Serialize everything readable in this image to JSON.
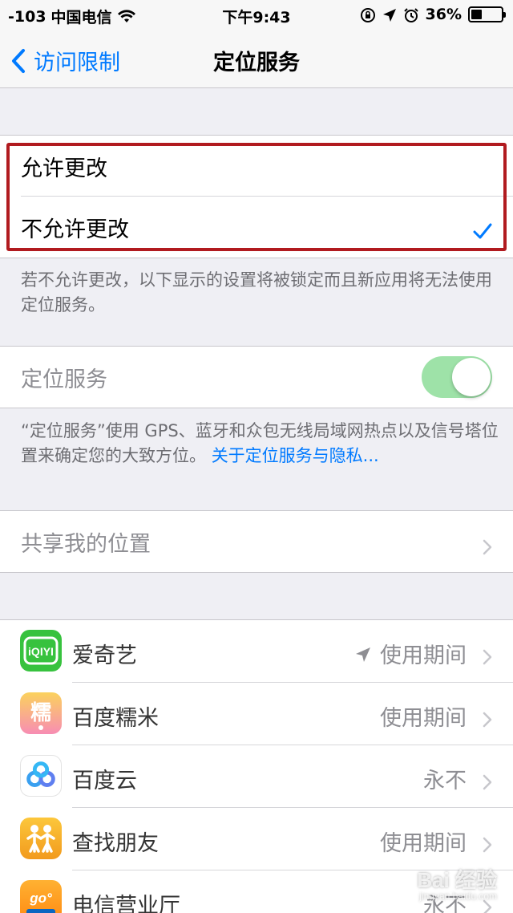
{
  "status_bar": {
    "signal": "-103",
    "carrier": "中国电信",
    "time": "下午9:43",
    "battery": "36%",
    "battery_level": 0.36
  },
  "nav": {
    "back_label": "访问限制",
    "title": "定位服务"
  },
  "change_options": [
    {
      "label": "允许更改",
      "selected": false
    },
    {
      "label": "不允许更改",
      "selected": true
    }
  ],
  "change_footnote": "若不允许更改，以下显示的设置将被锁定而且新应用将无法使用定位服务。",
  "location_services": {
    "label": "定位服务",
    "enabled": true,
    "footnote": "“定位服务”使用 GPS、蓝牙和众包无线局域网热点以及信号塔位置来确定您的大致方位。",
    "footnote_link": "关于定位服务与隐私..."
  },
  "share_location": {
    "label": "共享我的位置"
  },
  "apps": [
    {
      "name": "爱奇艺",
      "value": "使用期间",
      "location_arrow": true,
      "icon": "iqiyi-icon",
      "color": "#37c23e"
    },
    {
      "name": "百度糯米",
      "value": "使用期间",
      "location_arrow": false,
      "icon": "nuomi-icon",
      "color": "#f06aa0"
    },
    {
      "name": "百度云",
      "value": "永不",
      "location_arrow": false,
      "icon": "baiduyun-icon",
      "color": "#ffffff"
    },
    {
      "name": "查找朋友",
      "value": "使用期间",
      "location_arrow": false,
      "icon": "find-friends-icon",
      "color": "#f7a928"
    },
    {
      "name": "电信营业厅",
      "value": "永不",
      "location_arrow": false,
      "icon": "telecom-icon",
      "color": "#ff9d17"
    }
  ],
  "colors": {
    "accent": "#007aff",
    "highlight": "#b11a1f",
    "toggle_on": "#9ee2a8"
  },
  "watermark": {
    "text": "Bai 经验",
    "sub": "jingyan.baidu.com"
  }
}
